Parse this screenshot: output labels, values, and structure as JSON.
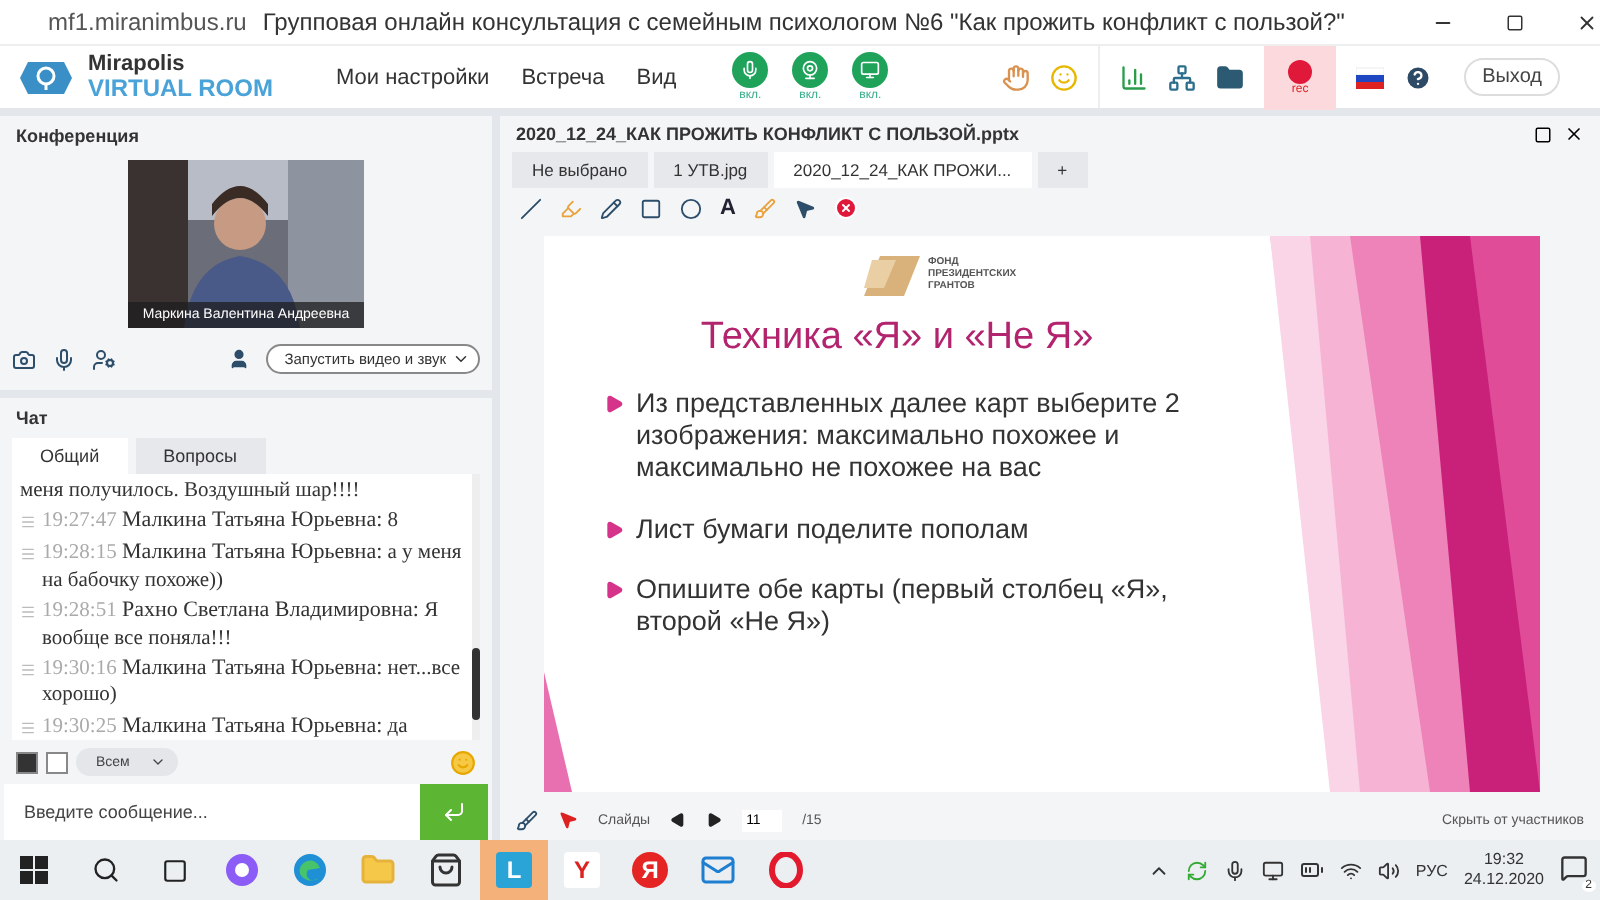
{
  "browser": {
    "url": "mf1.miranimbus.ru",
    "title": "Групповая онлайн консультация с семейным психологом №6 \"Как прожить конфликт с пользой?\""
  },
  "header": {
    "logo_top": "Mirapolis",
    "logo_bottom": "VIRTUAL ROOM",
    "menu": [
      "Мои настройки",
      "Встреча",
      "Вид"
    ],
    "media": [
      {
        "kind": "mic",
        "label": "вкл.",
        "on": true
      },
      {
        "kind": "camera",
        "label": "вкл.",
        "on": true
      },
      {
        "kind": "screen",
        "label": "вкл.",
        "on": true
      }
    ],
    "rec": "rec",
    "exit": "Выход"
  },
  "conference": {
    "title": "Конференция",
    "participant": "Маркина Валентина  Андреевна",
    "start_button": "Запустить видео и звук"
  },
  "chat": {
    "title": "Чат",
    "tabs": [
      {
        "label": "Общий",
        "selected": true
      },
      {
        "label": "Вопросы",
        "selected": false
      }
    ],
    "messages": [
      {
        "kind": "continuation",
        "text": "меня получилось. Воздушный шар!!!!"
      },
      {
        "kind": "message",
        "time": "19:27:47",
        "author": "Малкина Татьяна  Юрьевна:",
        "text": "8"
      },
      {
        "kind": "message",
        "time": "19:28:15",
        "author": "Малкина Татьяна  Юрьевна:",
        "text": "а у меня на бабочку похоже))"
      },
      {
        "kind": "message",
        "time": "19:28:51",
        "author": "Рахно Светлана  Владимировна:",
        "text": "Я вообще все поняла!!!"
      },
      {
        "kind": "message",
        "time": "19:30:16",
        "author": "Малкина Татьяна  Юрьевна:",
        "text": "нет...все хорошо)"
      },
      {
        "kind": "message",
        "time": "19:30:25",
        "author": "Малкина Татьяна  Юрьевна:",
        "text": "да"
      }
    ],
    "audience": "Всем",
    "placeholder": "Введите сообщение..."
  },
  "document": {
    "title": "2020_12_24_КАК ПРОЖИТЬ КОНФЛИКТ С ПОЛЬЗОЙ.pptx",
    "tabs": [
      {
        "label": "Не выбрано",
        "selected": false
      },
      {
        "label": "1 УТВ.jpg",
        "selected": false
      },
      {
        "label": "2020_12_24_КАК ПРОЖИ...",
        "selected": true
      }
    ],
    "add_tab": "+",
    "text_tool": "A"
  },
  "slide": {
    "logo_lines": [
      "ФОНД",
      "ПРЕЗИДЕНТСКИХ",
      "ГРАНТОВ"
    ],
    "title": "Техника «Я» и «Не Я»",
    "bullets": [
      "Из представленных далее карт выберите 2 изображения: максимально похожее и максимально не похожее на вас",
      "Лист бумаги поделите пополам",
      "Опишите обе карты (первый столбец «Я», второй «Не Я»)"
    ]
  },
  "footer": {
    "slides_label": "Слайды",
    "page": "11",
    "total": "/15",
    "hide": "Скрыть от участников"
  },
  "taskbar": {
    "apps": [
      {
        "kind": "alice",
        "selected": false
      },
      {
        "kind": "edge",
        "selected": false
      },
      {
        "kind": "folder",
        "selected": false
      },
      {
        "kind": "store",
        "selected": false
      },
      {
        "kind": "letter",
        "letter": "L",
        "selected": true
      },
      {
        "kind": "letter",
        "letter": "Y",
        "selected": false
      },
      {
        "kind": "round",
        "letter": "Я",
        "selected": false
      },
      {
        "kind": "mail",
        "selected": false
      },
      {
        "kind": "opera",
        "selected": false
      }
    ],
    "lang": "РУС",
    "time": "19:32",
    "date": "24.12.2020",
    "notifications": "2"
  }
}
